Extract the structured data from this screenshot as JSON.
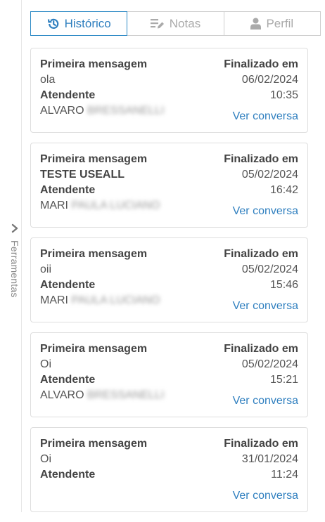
{
  "tabs": [
    {
      "label": "Histórico",
      "icon": "history-icon",
      "active": true
    },
    {
      "label": "Notas",
      "icon": "notes-icon",
      "active": false
    },
    {
      "label": "Perfil",
      "icon": "user-icon",
      "active": false
    }
  ],
  "side_panel": {
    "label": "Ferramentas",
    "icon": "chevron-right-icon"
  },
  "labels": {
    "first_message": "Primeira mensagem",
    "agent": "Atendente",
    "finished_at": "Finalizado em",
    "view_conversation": "Ver conversa"
  },
  "history": [
    {
      "first_message": "ola",
      "agent_first": "ALVARO",
      "agent_rest_blurred": "BRESSANELLI",
      "date": "06/02/2024",
      "time": "10:35"
    },
    {
      "first_message": "TESTE USEALL",
      "agent_first": "MARI",
      "agent_rest_blurred": "PAULA LUCIANO",
      "date": "05/02/2024",
      "time": "16:42"
    },
    {
      "first_message": "oii",
      "agent_first": "MARI",
      "agent_rest_blurred": "PAULA LUCIANO",
      "date": "05/02/2024",
      "time": "15:46"
    },
    {
      "first_message": "Oi",
      "agent_first": "ALVARO",
      "agent_rest_blurred": "BRESSANELLI",
      "date": "05/02/2024",
      "time": "15:21"
    },
    {
      "first_message": "Oi",
      "agent_first": "",
      "agent_rest_blurred": "",
      "date": "31/01/2024",
      "time": "11:24"
    }
  ],
  "colors": {
    "accent": "#2f7fbf",
    "border": "#dedede",
    "muted": "#aaaaaa"
  }
}
